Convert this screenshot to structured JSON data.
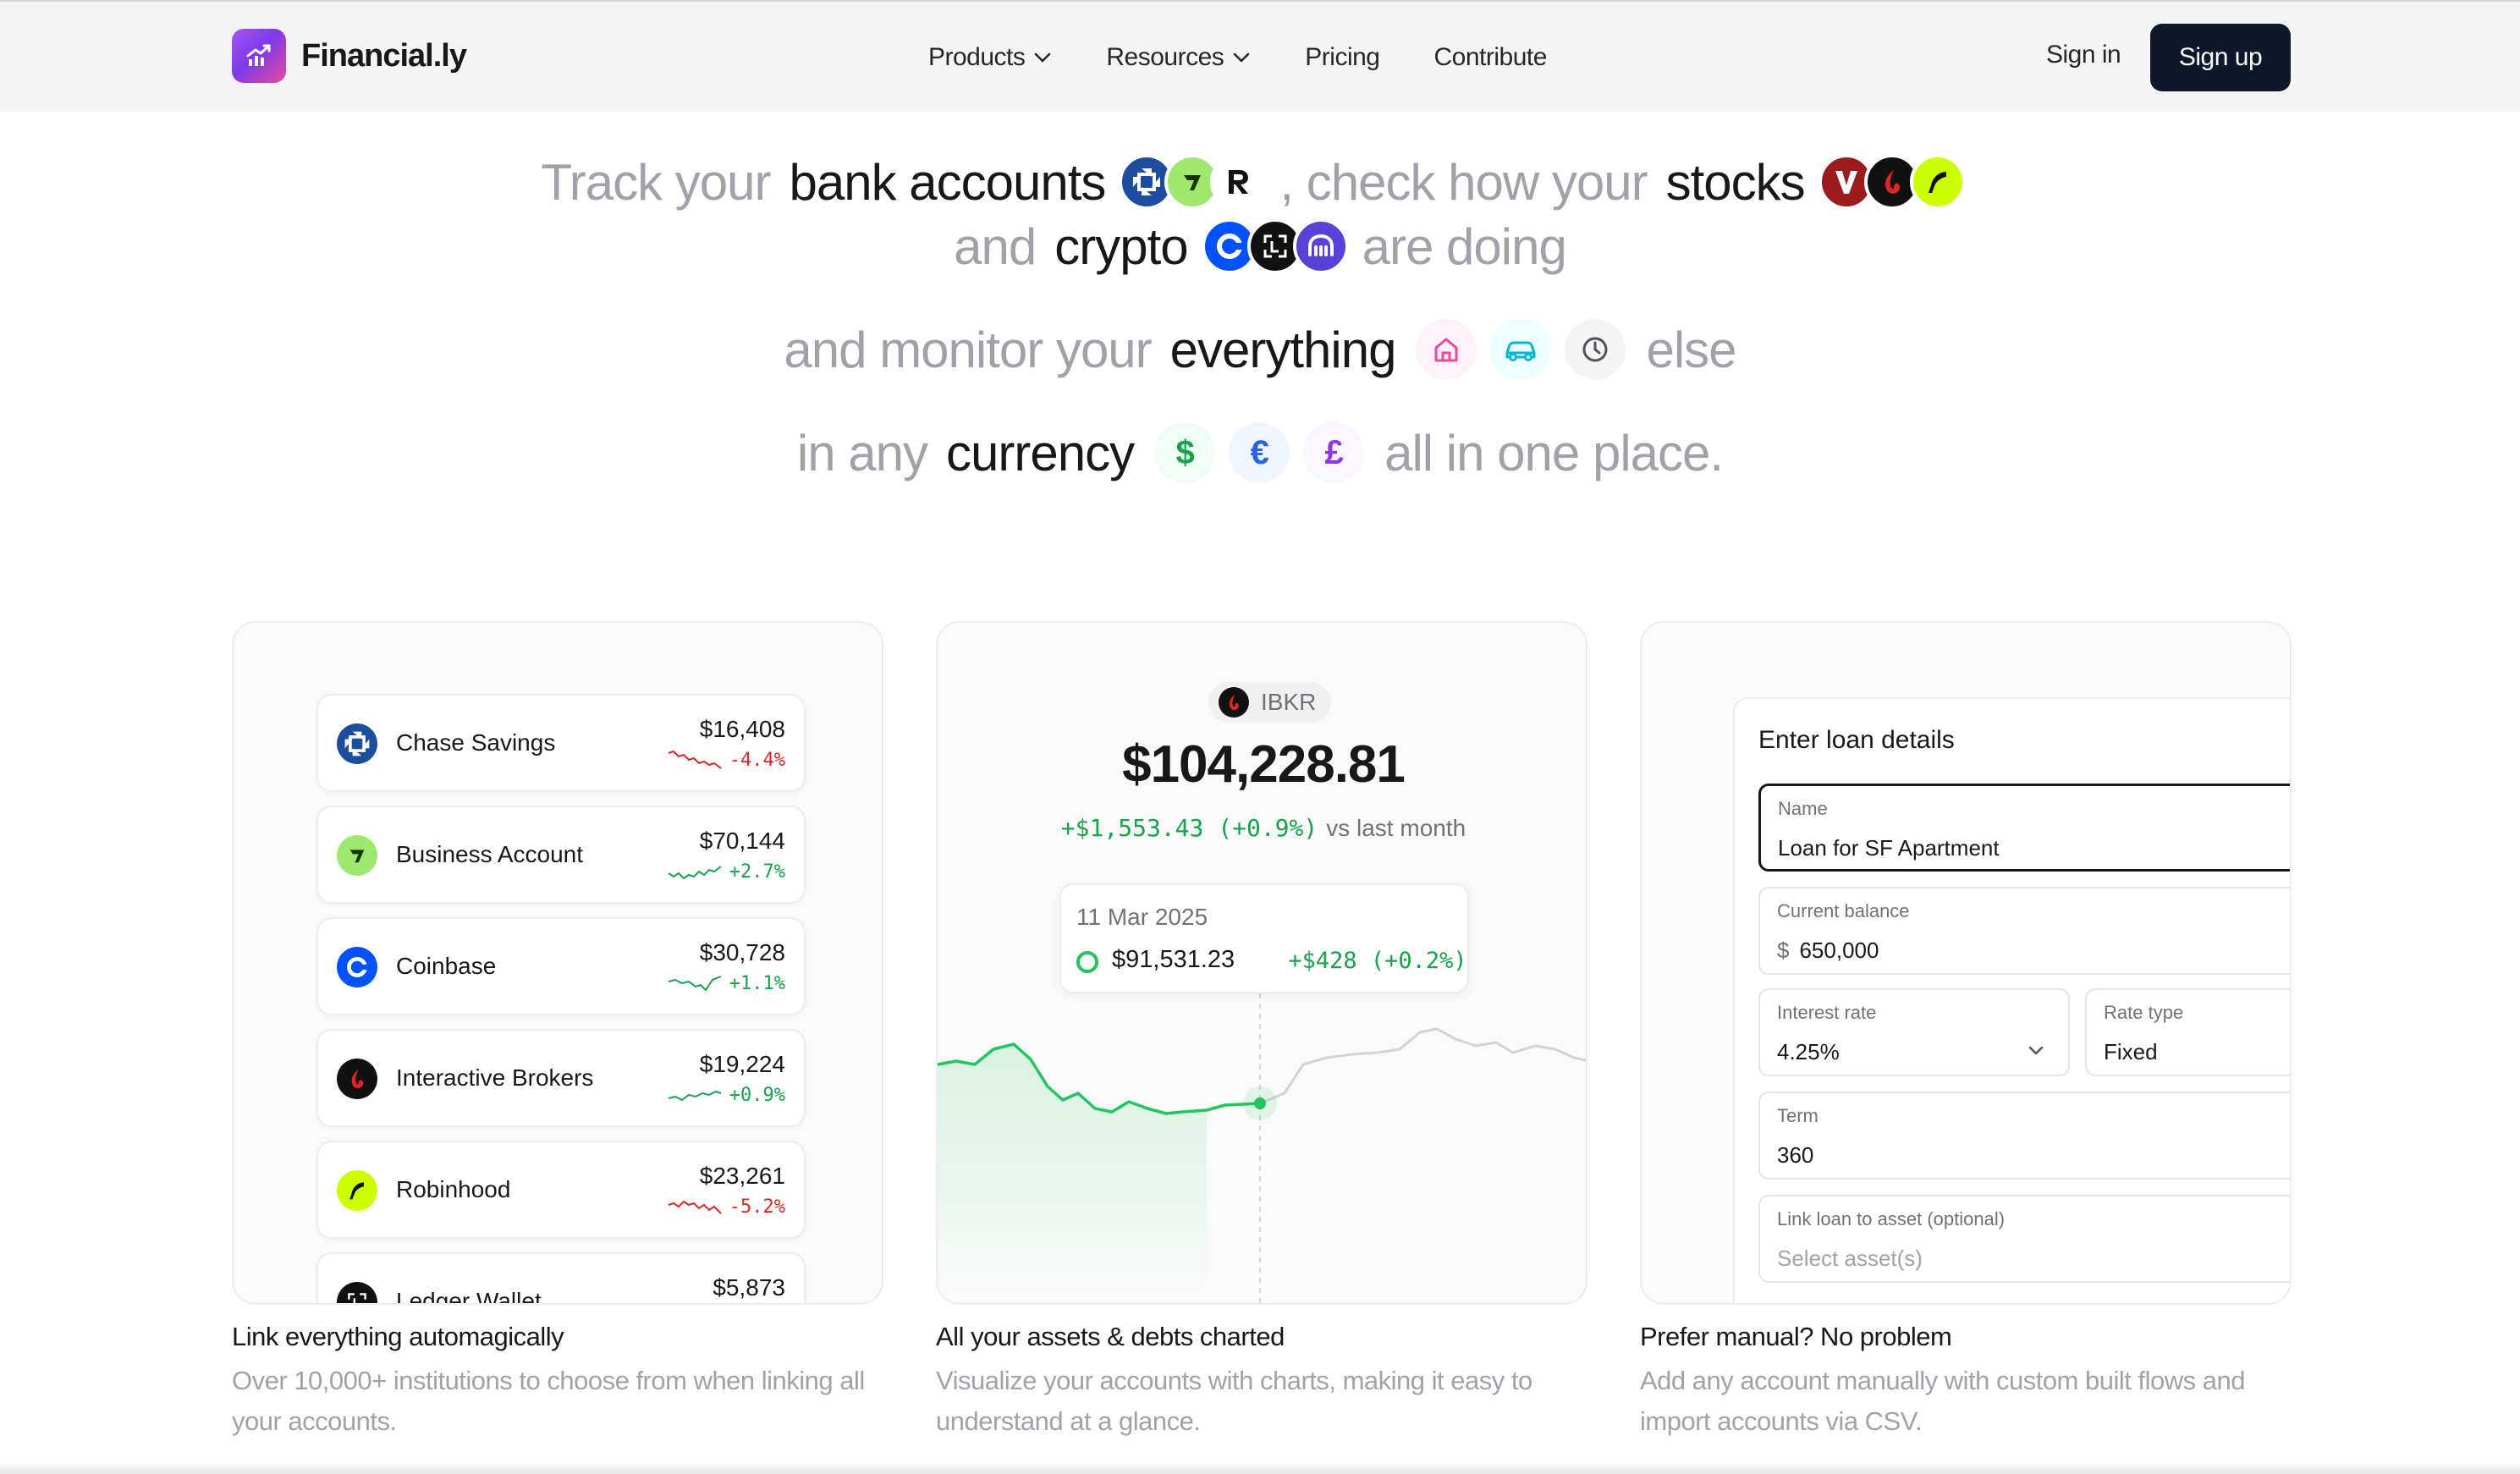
{
  "nav": {
    "brand": "Financial.ly",
    "links": [
      {
        "label": "Products",
        "dropdown": true
      },
      {
        "label": "Resources",
        "dropdown": true
      },
      {
        "label": "Pricing",
        "dropdown": false
      },
      {
        "label": "Contribute",
        "dropdown": false
      }
    ],
    "sign_in": "Sign in",
    "sign_up": "Sign up"
  },
  "hero": {
    "line1_a": "Track your",
    "line1_b": "bank accounts",
    "line1_c": ", check how your",
    "line1_d": "stocks",
    "line2_a": "and",
    "line2_b": "crypto",
    "line2_c": "are doing",
    "line3_a": "and monitor your",
    "line3_b": "everything",
    "line3_c": "else",
    "line4_a": "in any",
    "line4_b": "currency",
    "line4_c": "all in one place.",
    "currency_symbols": [
      "$",
      "€",
      "£"
    ],
    "colors": {
      "muted": "#a1a1aa",
      "strong": "#18181b"
    }
  },
  "cards": [
    {
      "title": "Link everything automagically",
      "desc": "Over 10,000+ institutions to choose from when linking all your accounts."
    },
    {
      "title": "All your assets & debts charted",
      "desc": "Visualize your accounts with charts, making it easy to understand at a glance."
    },
    {
      "title": "Prefer manual? No problem",
      "desc": "Add any account manually with custom built flows and import accounts via CSV."
    }
  ],
  "accounts": [
    {
      "name": "Chase Savings",
      "value": "$16,408",
      "change": "-4.4%",
      "trend": "down",
      "icon": "chase-icon"
    },
    {
      "name": "Business Account",
      "value": "$70,144",
      "change": "+2.7%",
      "trend": "up",
      "icon": "wise-icon"
    },
    {
      "name": "Coinbase",
      "value": "$30,728",
      "change": "+1.1%",
      "trend": "up",
      "icon": "coinbase-icon"
    },
    {
      "name": "Interactive Brokers",
      "value": "$19,224",
      "change": "+0.9%",
      "trend": "up",
      "icon": "ibkr-icon"
    },
    {
      "name": "Robinhood",
      "value": "$23,261",
      "change": "-5.2%",
      "trend": "down",
      "icon": "robinhood-icon"
    },
    {
      "name": "Ledger Wallet",
      "value": "$5,873",
      "change": "",
      "trend": "",
      "icon": "ledger-icon"
    }
  ],
  "chart_card": {
    "ticker": "IBKR",
    "value": "$104,228.81",
    "change": "+$1,553.43 (+0.9%)",
    "vs": "vs last month",
    "tooltip_date": "11 Mar 2025",
    "tooltip_value": "$91,531.23",
    "tooltip_change": "+$428 (+0.2%)",
    "line_color": "#22c55e"
  },
  "loan_form": {
    "title": "Enter loan details",
    "name_label": "Name",
    "name_value": "Loan for SF Apartment",
    "balance_label": "Current balance",
    "balance_prefix": "$",
    "balance_value": "650,000",
    "rate_label": "Interest rate",
    "rate_value": "4.25%",
    "rate_type_label": "Rate type",
    "rate_type_value": "Fixed",
    "term_label": "Term",
    "term_value": "360",
    "link_label": "Link loan to asset (optional)",
    "link_placeholder": "Select asset(s)"
  }
}
